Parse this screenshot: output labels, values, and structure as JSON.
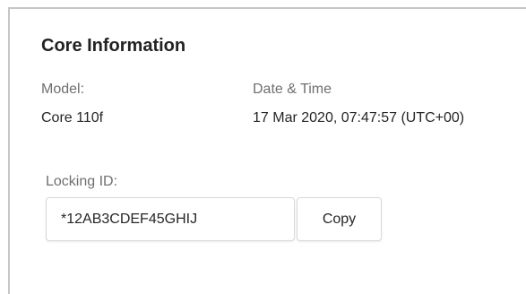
{
  "card": {
    "title": "Core Information",
    "model": {
      "label": "Model:",
      "value": "Core 110f"
    },
    "datetime": {
      "label": "Date & Time",
      "value": "17 Mar 2020, 07:47:57 (UTC+00)"
    },
    "locking_id": {
      "label": "Locking ID:",
      "value": "*12AB3CDEF45GHIJ"
    },
    "copy_button_label": "Copy"
  },
  "colors": {
    "border": "#c6c6c6",
    "label_text": "#6f6f6f",
    "value_text": "#262626"
  }
}
